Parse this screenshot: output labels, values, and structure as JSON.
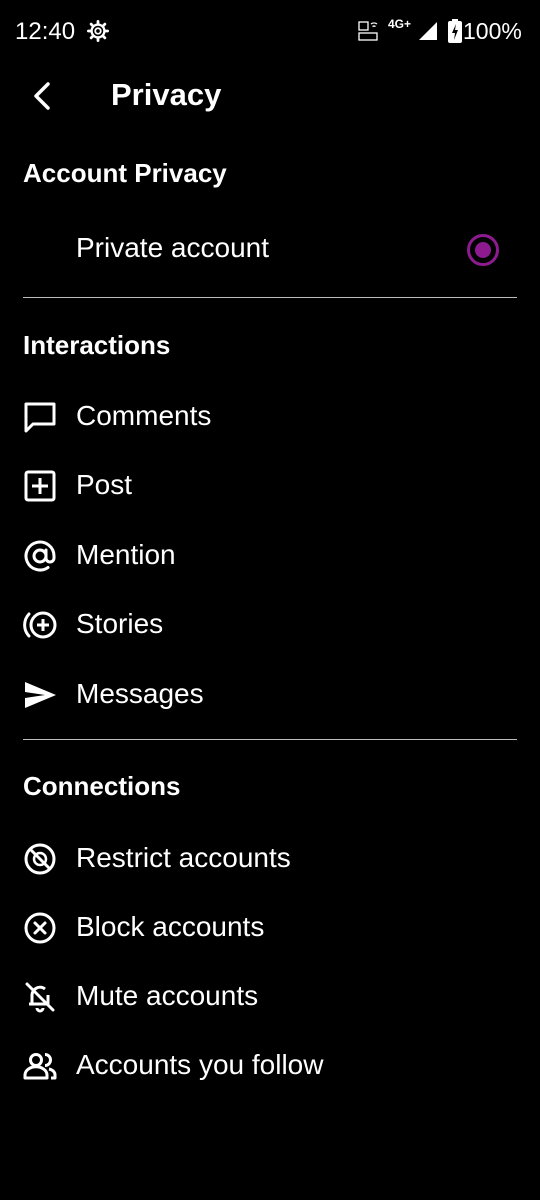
{
  "status": {
    "time": "12:40",
    "network": "4G+",
    "battery": "100%"
  },
  "header": {
    "title": "Privacy"
  },
  "account_privacy": {
    "title": "Account Privacy",
    "private_account_label": "Private account",
    "private_account_selected": true,
    "accent_color": "#8e1a8f"
  },
  "interactions": {
    "title": "Interactions",
    "items": [
      {
        "label": "Comments",
        "icon": "comment-icon"
      },
      {
        "label": "Post",
        "icon": "plus-square-icon"
      },
      {
        "label": "Mention",
        "icon": "at-icon"
      },
      {
        "label": "Stories",
        "icon": "story-add-icon"
      },
      {
        "label": "Messages",
        "icon": "send-icon"
      }
    ]
  },
  "connections": {
    "title": "Connections",
    "items": [
      {
        "label": "Restrict accounts",
        "icon": "restrict-icon"
      },
      {
        "label": "Block accounts",
        "icon": "block-icon"
      },
      {
        "label": "Mute accounts",
        "icon": "bell-off-icon"
      },
      {
        "label": "Accounts you follow",
        "icon": "people-icon"
      }
    ]
  }
}
